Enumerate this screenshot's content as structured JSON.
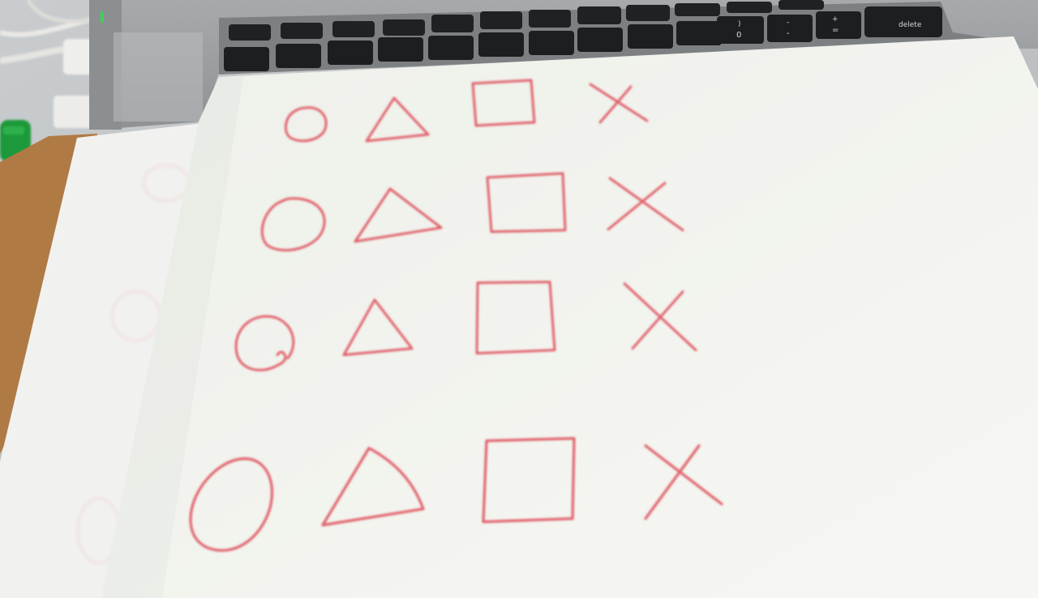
{
  "photo": {
    "description_free": true,
    "keyboard": {
      "delete_key_label": "delete",
      "number_keys": [
        {
          "top": ")",
          "bottom": "0"
        },
        {
          "top": "-",
          "bottom": "-"
        },
        {
          "top": "+",
          "bottom": "="
        }
      ]
    },
    "paper_shapes": {
      "ink_color": "#e0626c",
      "rows": [
        [
          "circle-icon",
          "triangle-icon",
          "square-icon",
          "cross-icon"
        ],
        [
          "circle-icon",
          "triangle-icon",
          "square-icon",
          "cross-icon"
        ],
        [
          "circle-icon",
          "triangle-icon",
          "square-icon",
          "cross-icon"
        ],
        [
          "circle-icon",
          "triangle-icon",
          "square-icon",
          "cross-icon"
        ]
      ]
    },
    "status_led_color": "#39d353"
  }
}
